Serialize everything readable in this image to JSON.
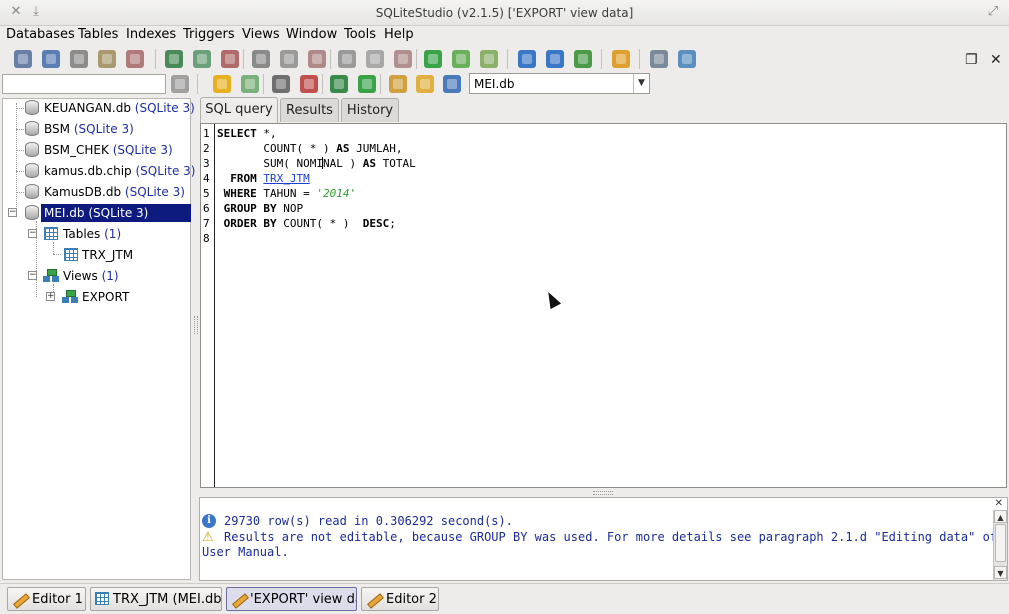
{
  "window": {
    "title": "SQLiteStudio (v2.1.5) ['EXPORT' view data]",
    "pin_glyph": "✕",
    "down_glyph": "⤓",
    "expand_glyph": "⤢"
  },
  "menu": [
    "Databases",
    "Tables",
    "Indexes",
    "Triggers",
    "Views",
    "Window",
    "Tools",
    "Help"
  ],
  "toolbar": {
    "db_select_value": "MEI.db",
    "db_select_arrow": "▼",
    "mdi_restore_glyph": "❐",
    "mdi_close_glyph": "✕",
    "icon_colors": {
      "connect": "#6a7fa8",
      "disconnect": "#5b7fb5",
      "db_add": "#8c8c8c",
      "db_edit": "#a89a6e",
      "db_remove": "#b07a7a",
      "table_add": "#4a8a5a",
      "table_edit": "#6aa07a",
      "table_remove": "#b06a6a",
      "index": "#8a8a8a",
      "trigger": "#9a9a9a",
      "view": "#3aa34a",
      "window": "#3a77c7",
      "tools": "#e0a030",
      "config": "#5a8fc0"
    }
  },
  "tree": {
    "databases": [
      {
        "name": "KEUANGAN.db",
        "type": "(SQLite 3)"
      },
      {
        "name": "BSM",
        "type": "(SQLite 3)"
      },
      {
        "name": "BSM_CHEK",
        "type": "(SQLite 3)"
      },
      {
        "name": "kamus.db.chip",
        "type": "(SQLite 3)"
      },
      {
        "name": "KamusDB.db",
        "type": "(SQLite 3)"
      },
      {
        "name": "MEI.db",
        "type": "(SQLite 3)"
      }
    ],
    "tables_label": "Tables",
    "tables_count": "(1)",
    "table_item": "TRX_JTM",
    "views_label": "Views",
    "views_count": "(1)",
    "view_item": "EXPORT",
    "collapse_glyph": "−",
    "expand_glyph": "+"
  },
  "tabs": [
    "SQL query",
    "Results",
    "History"
  ],
  "editor": {
    "line_numbers": [
      "1",
      "2",
      "3",
      "4",
      "5",
      "6",
      "7",
      "8"
    ],
    "l1_kw": "SELECT",
    "l1_rest": " *,",
    "l2_pre": "       COUNT( * ) ",
    "l2_kw": "AS",
    "l2_rest": " JUMLAH,",
    "l3_pre": "       SUM( NOMI",
    "l3_post": "NAL ) ",
    "l3_kw": "AS",
    "l3_rest": " TOTAL",
    "l4_kw": "  FROM",
    "l4_table": "TRX_JTM",
    "l5_kw": " WHERE",
    "l5_mid": " TAHUN = ",
    "l5_str": "'2014'",
    "l6_kw": " GROUP BY",
    "l6_rest": " NOP",
    "l7_kw": " ORDER BY",
    "l7_mid": " COUNT( * )  ",
    "l7_kw2": "DESC",
    "l7_rest": ";"
  },
  "messages": {
    "close_glyph": "✕",
    "info_glyph": "i",
    "warn_glyph": "⚠",
    "line1": "29730 row(s) read in 0.306292 second(s).",
    "line2": "Results are not editable, because GROUP BY was used. For more details see paragraph 2.1.d \"Editing data\" of",
    "line3": "User Manual.",
    "scroll_up": "▲",
    "scroll_down": "▼"
  },
  "taskbar": [
    {
      "label": "Editor 1"
    },
    {
      "label": "TRX_JTM (MEI.db)"
    },
    {
      "label": "'EXPORT' view data"
    },
    {
      "label": "Editor 2"
    }
  ]
}
